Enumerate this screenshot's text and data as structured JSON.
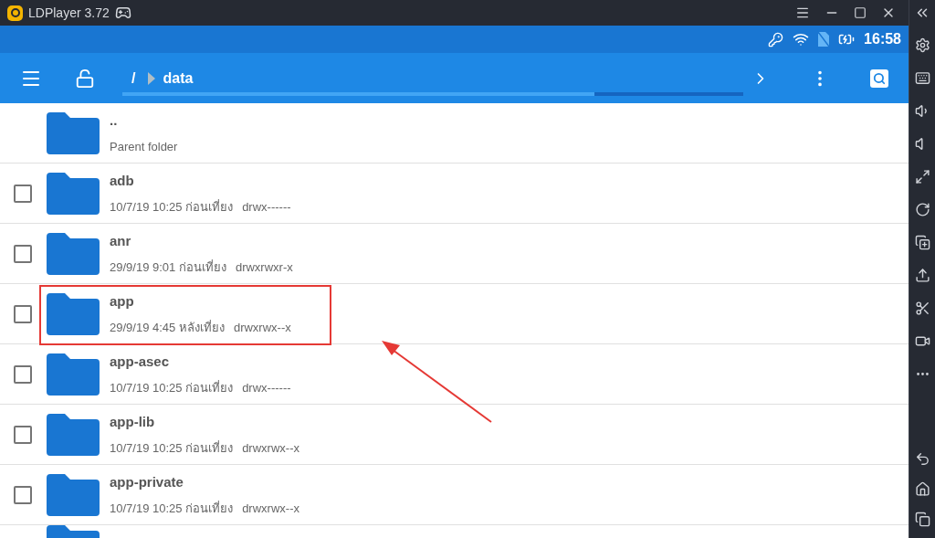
{
  "window": {
    "title": "LDPlayer 3.72"
  },
  "status_bar": {
    "time": "16:58"
  },
  "toolbar": {
    "path_root": "/",
    "path_current": "data"
  },
  "entries": [
    {
      "kind": "parent",
      "name": "..",
      "meta": "Parent folder",
      "highlighted": false
    },
    {
      "kind": "folder",
      "name": "adb",
      "date": "10/7/19 10:25 ก่อนเที่ยง",
      "permissions": "drwx------",
      "checked": false,
      "highlighted": false
    },
    {
      "kind": "folder",
      "name": "anr",
      "date": "29/9/19 9:01 ก่อนเที่ยง",
      "permissions": "drwxrwxr-x",
      "checked": false,
      "highlighted": false
    },
    {
      "kind": "folder",
      "name": "app",
      "date": "29/9/19 4:45 หลังเที่ยง",
      "permissions": "drwxrwx--x",
      "checked": false,
      "highlighted": true
    },
    {
      "kind": "folder",
      "name": "app-asec",
      "date": "10/7/19 10:25 ก่อนเที่ยง",
      "permissions": "drwx------",
      "checked": false,
      "highlighted": false
    },
    {
      "kind": "folder",
      "name": "app-lib",
      "date": "10/7/19 10:25 ก่อนเที่ยง",
      "permissions": "drwxrwx--x",
      "checked": false,
      "highlighted": false
    },
    {
      "kind": "folder",
      "name": "app-private",
      "date": "10/7/19 10:25 ก่อนเที่ยง",
      "permissions": "drwxrwx--x",
      "checked": false,
      "highlighted": false
    }
  ]
}
